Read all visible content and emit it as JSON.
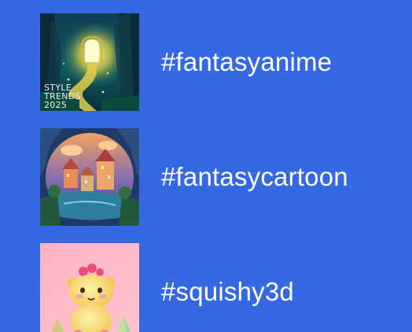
{
  "tags": [
    {
      "label": "#fantasyanime",
      "thumbnail": {
        "icon": "fantasy-forest-doorway-image",
        "overlay_lines": [
          "STYLE",
          "TRENDS",
          "2025"
        ]
      }
    },
    {
      "label": "#fantasycartoon",
      "thumbnail": {
        "icon": "fantasy-cartoon-village-image"
      }
    },
    {
      "label": "#squishy3d",
      "thumbnail": {
        "icon": "squishy-3d-character-image"
      }
    }
  ],
  "colors": {
    "background": "#3568e3",
    "text": "#ffffff"
  }
}
